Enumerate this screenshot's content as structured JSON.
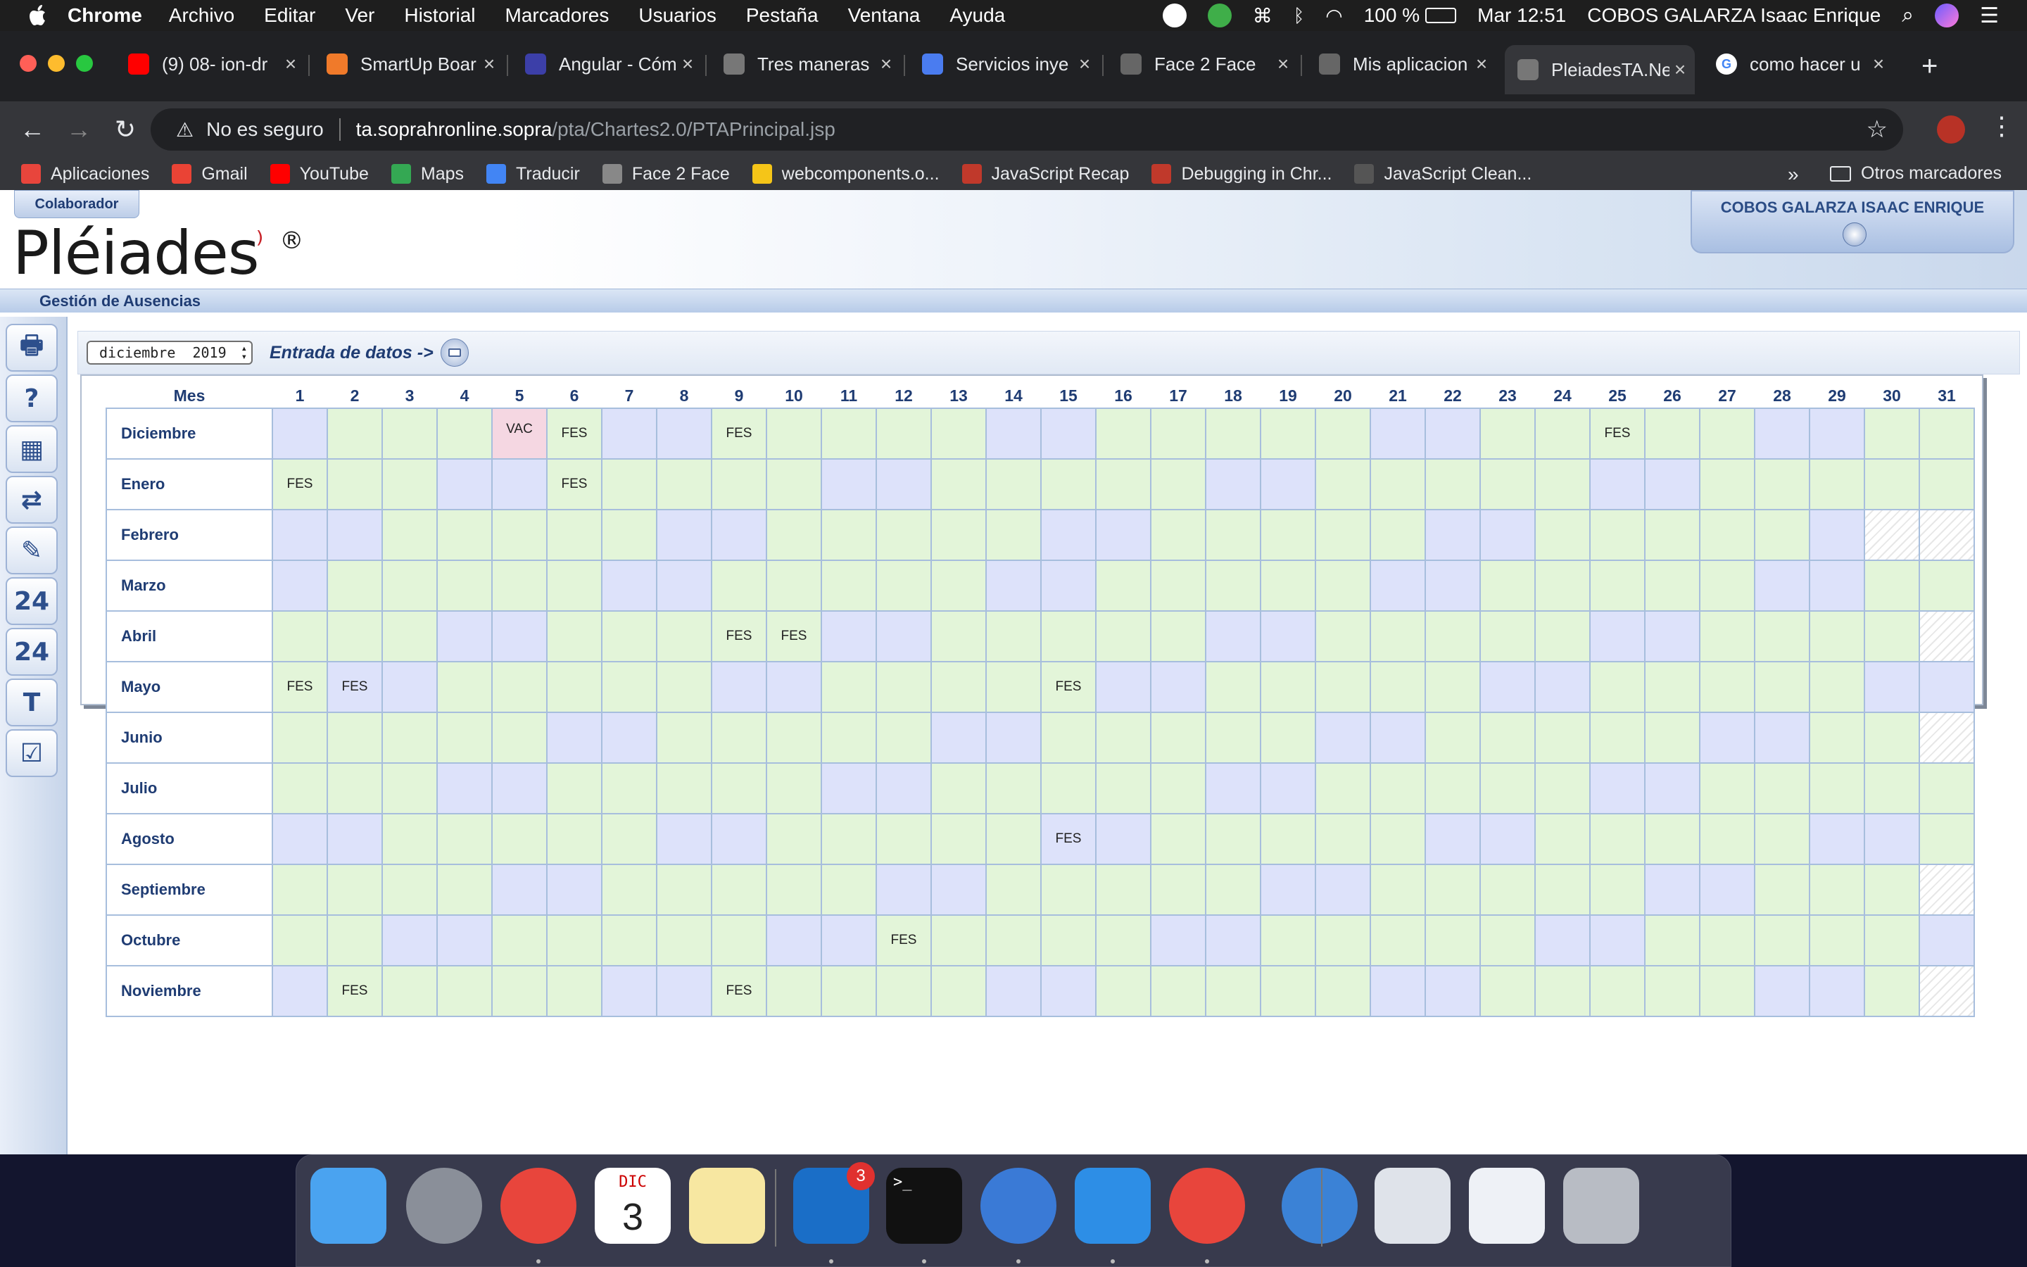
{
  "menubar": {
    "app": "Chrome",
    "items": [
      "Archivo",
      "Editar",
      "Ver",
      "Historial",
      "Marcadores",
      "Usuarios",
      "Pestaña",
      "Ventana",
      "Ayuda"
    ],
    "battery": "100 %",
    "clock": "Mar 12:51",
    "user": "COBOS GALARZA Isaac Enrique"
  },
  "tabs": [
    {
      "title": "(9) 08- ion-dr",
      "icon": "youtube-icon",
      "color": "#ff0000"
    },
    {
      "title": "SmartUp Boar",
      "icon": "smartup-icon",
      "color": "#f07a2a"
    },
    {
      "title": "Angular - Cóm",
      "icon": "angular-icon",
      "color": "#3c3fa8"
    },
    {
      "title": "Tres maneras",
      "icon": "globe-icon",
      "color": "#777777"
    },
    {
      "title": "Servicios inye",
      "icon": "ab-icon",
      "color": "#4a7cf0"
    },
    {
      "title": "Face 2 Face",
      "icon": "face2face-icon",
      "color": "#666666"
    },
    {
      "title": "Mis aplicacion",
      "icon": "face2face-icon",
      "color": "#666666"
    },
    {
      "title": "PleiadesTA.Ne",
      "icon": "globe-icon",
      "color": "#777777"
    },
    {
      "title": "como hacer u",
      "icon": "google-icon",
      "color": "#ffffff"
    }
  ],
  "address": {
    "security": "No es seguro",
    "host": "ta.soprahronline.sopra",
    "path": "/pta/Chartes2.0/PTAPrincipal.jsp"
  },
  "bookmarks": [
    {
      "label": "Aplicaciones",
      "color": "#e8453c"
    },
    {
      "label": "Gmail",
      "color": "#ea4335"
    },
    {
      "label": "YouTube",
      "color": "#ff0000"
    },
    {
      "label": "Maps",
      "color": "#34a853"
    },
    {
      "label": "Traducir",
      "color": "#4285f4"
    },
    {
      "label": "Face 2 Face",
      "color": "#888888"
    },
    {
      "label": "webcomponents.o...",
      "color": "#f5c518"
    },
    {
      "label": "JavaScript Recap",
      "color": "#c0392b"
    },
    {
      "label": "Debugging in Chr...",
      "color": "#c0392b"
    },
    {
      "label": "JavaScript Clean...",
      "color": "#555555"
    }
  ],
  "bookmarks_more": "»",
  "bookmarks_other": "Otros marcadores",
  "app": {
    "role": "Colaborador",
    "logo": "Pléiades",
    "logo_mark": "®",
    "user": "COBOS GALARZA ISAAC ENRIQUE",
    "section": "Gestión de Ausencias",
    "month_select": "diciembre  2019",
    "entry_label": "Entrada de datos ->"
  },
  "calendar": {
    "month_header": "Mes",
    "days": [
      "1",
      "2",
      "3",
      "4",
      "5",
      "6",
      "7",
      "8",
      "9",
      "10",
      "11",
      "12",
      "13",
      "14",
      "15",
      "16",
      "17",
      "18",
      "19",
      "20",
      "21",
      "22",
      "23",
      "24",
      "25",
      "26",
      "27",
      "28",
      "29",
      "30",
      "31"
    ],
    "rows": [
      {
        "month": "Diciembre",
        "weekend": [
          1,
          7,
          8,
          14,
          15,
          21,
          22,
          28,
          29
        ],
        "days_in_month": 31,
        "marks": {
          "5": "VAC",
          "6": "FES",
          "9": "FES",
          "25": "FES"
        }
      },
      {
        "month": "Enero",
        "weekend": [
          4,
          5,
          11,
          12,
          18,
          19,
          25,
          26
        ],
        "days_in_month": 31,
        "marks": {
          "1": "FES",
          "6": "FES"
        }
      },
      {
        "month": "Febrero",
        "weekend": [
          1,
          2,
          8,
          9,
          15,
          16,
          22,
          23,
          29
        ],
        "days_in_month": 29,
        "marks": {}
      },
      {
        "month": "Marzo",
        "weekend": [
          1,
          7,
          8,
          14,
          15,
          21,
          22,
          28,
          29
        ],
        "days_in_month": 31,
        "marks": {}
      },
      {
        "month": "Abril",
        "weekend": [
          4,
          5,
          11,
          12,
          18,
          19,
          25,
          26
        ],
        "days_in_month": 30,
        "marks": {
          "9": "FES",
          "10": "FES"
        }
      },
      {
        "month": "Mayo",
        "weekend": [
          2,
          3,
          9,
          10,
          16,
          17,
          23,
          24,
          30,
          31
        ],
        "days_in_month": 31,
        "marks": {
          "1": "FES",
          "2": "FES",
          "15": "FES"
        }
      },
      {
        "month": "Junio",
        "weekend": [
          6,
          7,
          13,
          14,
          20,
          21,
          27,
          28
        ],
        "days_in_month": 30,
        "marks": {}
      },
      {
        "month": "Julio",
        "weekend": [
          4,
          5,
          11,
          12,
          18,
          19,
          25,
          26
        ],
        "days_in_month": 31,
        "marks": {}
      },
      {
        "month": "Agosto",
        "weekend": [
          1,
          2,
          8,
          9,
          15,
          16,
          22,
          23,
          29,
          30
        ],
        "days_in_month": 31,
        "marks": {
          "15": "FES"
        }
      },
      {
        "month": "Septiembre",
        "weekend": [
          5,
          6,
          12,
          13,
          19,
          20,
          26,
          27
        ],
        "days_in_month": 30,
        "marks": {}
      },
      {
        "month": "Octubre",
        "weekend": [
          3,
          4,
          10,
          11,
          17,
          18,
          24,
          25,
          31
        ],
        "days_in_month": 31,
        "marks": {
          "12": "FES"
        }
      },
      {
        "month": "Noviembre",
        "weekend": [
          1,
          7,
          8,
          14,
          15,
          21,
          22,
          28,
          29
        ],
        "days_in_month": 30,
        "marks": {
          "2": "FES",
          "9": "FES"
        }
      }
    ]
  },
  "sidebar_icons": [
    "print-icon",
    "help-icon",
    "calendar-grid-icon",
    "transfer-icon",
    "edit-table-icon",
    "calendar-24-icon",
    "calendar-24-alt-icon",
    "timetable-icon",
    "checklist-icon"
  ],
  "dock": [
    {
      "name": "finder-icon",
      "color": "#4aa3f0"
    },
    {
      "name": "launchpad-icon",
      "color": "#8a8f99"
    },
    {
      "name": "chrome-icon",
      "color": "#e8453c"
    },
    {
      "name": "calendar-icon",
      "color": "#ffffff",
      "label_top": "DIC",
      "label_num": "3"
    },
    {
      "name": "notes-icon",
      "color": "#f7e7a1"
    },
    {
      "name": "outlook-icon",
      "color": "#1a6ec7",
      "badge": "3"
    },
    {
      "name": "terminal-icon",
      "color": "#111111",
      "label_top": ">_"
    },
    {
      "name": "quicktime-icon",
      "color": "#3a7ad6"
    },
    {
      "name": "vscode-icon",
      "color": "#2d8ee6"
    },
    {
      "name": "chrome-icon",
      "color": "#e8453c"
    },
    {
      "name": "globe-icon",
      "color": "#3b82d6"
    },
    {
      "name": "window-preview-icon",
      "color": "#dfe3ea"
    },
    {
      "name": "window-preview-icon",
      "color": "#eef1f6"
    },
    {
      "name": "trash-icon",
      "color": "#b8bcc4"
    }
  ]
}
